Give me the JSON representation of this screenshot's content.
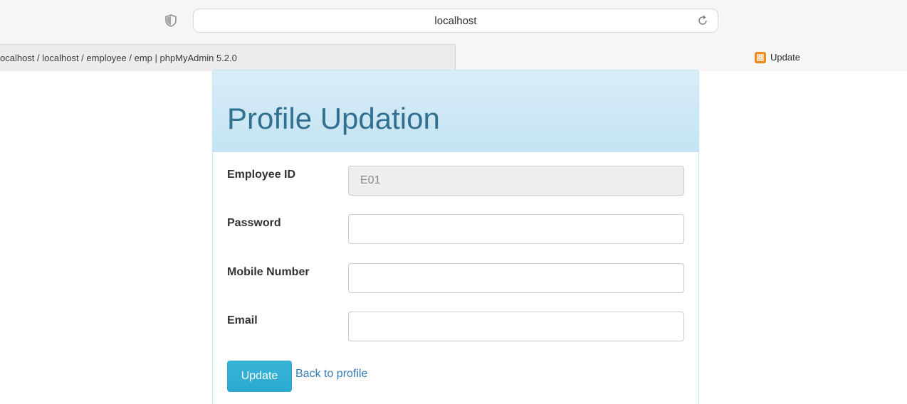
{
  "browser": {
    "url": "localhost",
    "tabs": [
      {
        "title": "ocalhost / localhost / employee / emp | phpMyAdmin 5.2.0"
      },
      {
        "title": "Update"
      }
    ]
  },
  "form": {
    "heading": "Profile Updation",
    "fields": [
      {
        "label": "Employee ID",
        "value": "E01",
        "disabled": true
      },
      {
        "label": "Password",
        "value": ""
      },
      {
        "label": "Mobile Number",
        "value": ""
      },
      {
        "label": "Email",
        "value": ""
      }
    ],
    "submit_label": "Update",
    "back_link": "Back to profile"
  },
  "colors": {
    "heading_text": "#31708f",
    "heading_bg": "#d9edf7",
    "button_bg": "#2aabd2",
    "link": "#337ab7",
    "favicon": "#f08a1c"
  }
}
